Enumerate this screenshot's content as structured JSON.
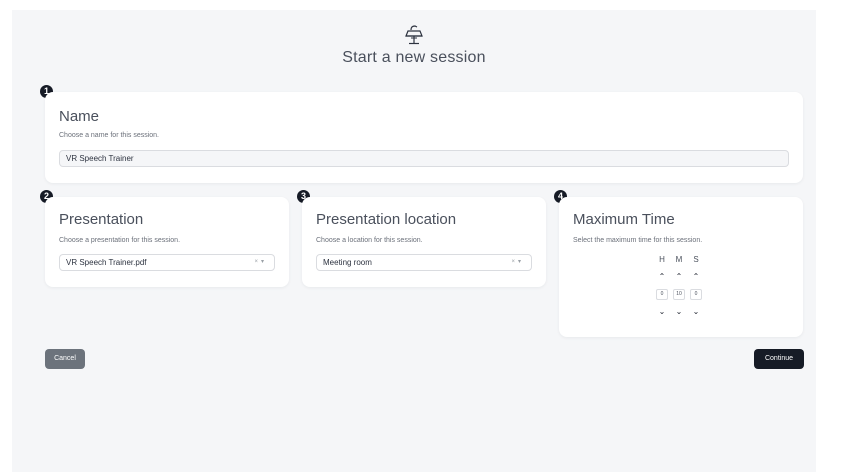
{
  "header": {
    "title": "Start a new session",
    "icon": "podium-icon"
  },
  "steps": [
    "1",
    "2",
    "3",
    "4"
  ],
  "name_card": {
    "title": "Name",
    "subtitle": "Choose a name for this session.",
    "value": "VR Speech Trainer"
  },
  "presentation_card": {
    "title": "Presentation",
    "subtitle": "Choose a presentation for this session.",
    "selected": "VR Speech Trainer.pdf"
  },
  "location_card": {
    "title": "Presentation location",
    "subtitle": "Choose a location for this session.",
    "selected": "Meeting room"
  },
  "time_card": {
    "title": "Maximum Time",
    "subtitle": "Select the maximum time for this session.",
    "labels": [
      "H",
      "M",
      "S"
    ],
    "values": {
      "hours": "0",
      "minutes": "10",
      "seconds": "0"
    }
  },
  "select_controls": {
    "clear": "×",
    "caret": "▾"
  },
  "arrows": {
    "up": "⌃",
    "down": "⌄"
  },
  "actions": {
    "cancel": "Cancel",
    "continue": "Continue"
  },
  "colors": {
    "background": "#f5f6f8",
    "card": "#ffffff",
    "primary_button": "#161b26",
    "secondary_button": "#6c737c",
    "badge": "#161b26"
  }
}
